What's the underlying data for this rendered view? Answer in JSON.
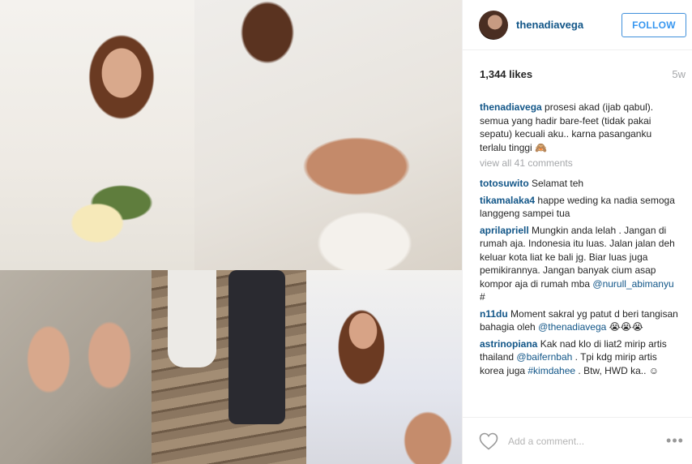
{
  "post": {
    "photos": [
      {
        "label": "bride-veil-bouquet"
      },
      {
        "label": "holding-hands"
      },
      {
        "label": "hands-rings"
      },
      {
        "label": "barefoot-walking"
      },
      {
        "label": "bride-portrait"
      }
    ]
  },
  "header": {
    "username": "thenadiavega",
    "follow_label": "FOLLOW"
  },
  "stats": {
    "likes": "1,344 likes",
    "age": "5w"
  },
  "caption": {
    "author": "thenadiavega",
    "text": "prosesi akad (ijab qabul). semua yang hadir bare-feet (tidak pakai sepatu) kecuali aku.. karna pasanganku terlalu tinggi 🙈"
  },
  "view_all": "view all 41 comments",
  "comments": [
    {
      "author": "totosuwito",
      "text": "Selamat teh"
    },
    {
      "author": "tikamalaka4",
      "text": "happe weding ka nadia semoga langgeng sampei tua"
    },
    {
      "author": "aprilapriell",
      "text": "Mungkin anda lelah . Jangan di rumah aja. Indonesia itu luas. Jalan jalan deh keluar kota liat ke bali jg. Biar luas juga pemikirannya. Jangan banyak cium asap kompor aja di rumah mba",
      "mention": "@nurull_abimanyu",
      "suffix": " #"
    },
    {
      "author": "n11du",
      "text": "Moment sakral yg patut d beri tangisan bahagia oleh",
      "mention": "@thenadiavega",
      "suffix": " 😭😭😭"
    },
    {
      "author": "astrinopiana",
      "text": "Kak nad klo di liat2 mirip artis thailand",
      "mention": "@baifernbah",
      "suffix": " . Tpi kdg mirip artis korea juga ",
      "mention2": "#kimdahee",
      "suffix2": " . Btw, HWD ka.. ☺"
    }
  ],
  "footer": {
    "comment_placeholder": "Add a comment...",
    "more_label": "•••"
  },
  "colors": {
    "link": "#125688",
    "follow_blue": "#3897f0",
    "muted": "#a5a7aa"
  }
}
